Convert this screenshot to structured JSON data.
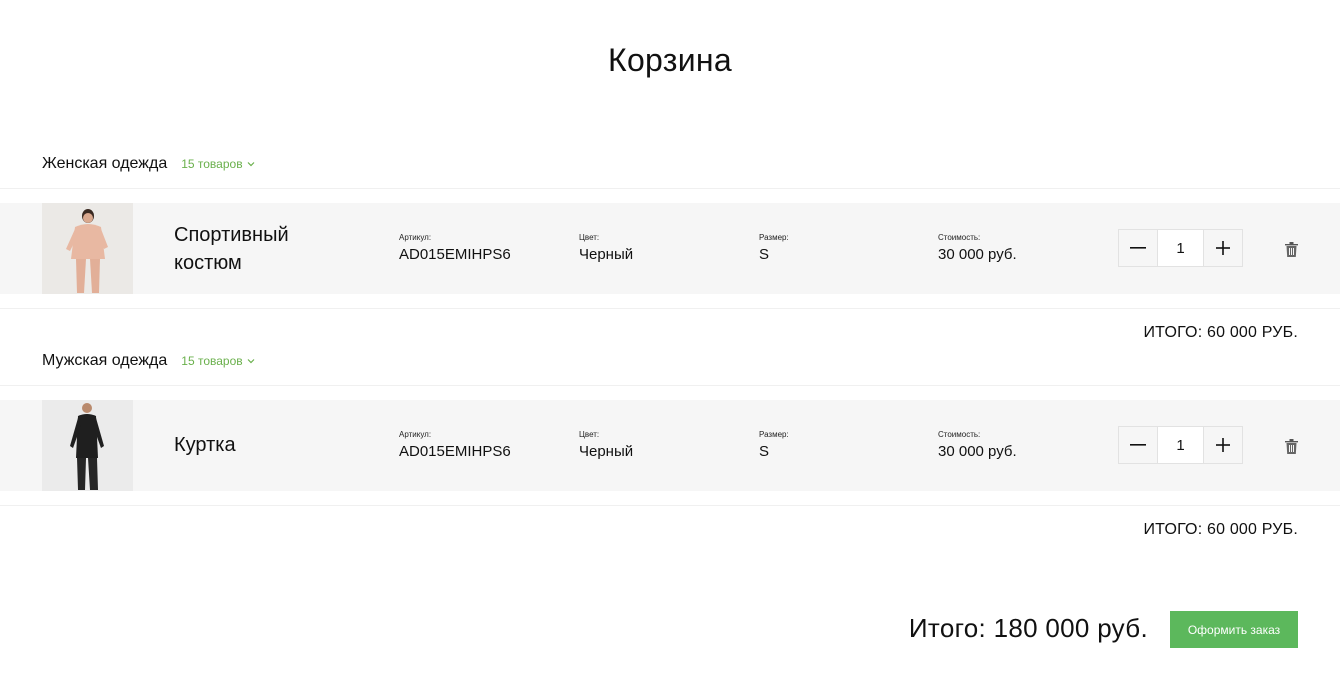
{
  "page": {
    "title": "Корзина"
  },
  "sections": [
    {
      "title": "Женская одежда",
      "count": "15 товаров",
      "item": {
        "name_line1": "Спортивный",
        "name_line2": "костюм",
        "sku_label": "Артикул:",
        "sku": "AD015EMIHPS6",
        "color_label": "Цвет:",
        "color": "Черный",
        "size_label": "Размер:",
        "size": "S",
        "price_label": "Стоимость:",
        "price": "30 000 руб.",
        "quantity": "1"
      },
      "subtotal": "ИТОГО: 60 000 РУБ."
    },
    {
      "title": "Мужская одежда",
      "count": "15 товаров",
      "item": {
        "name_line1": "Куртка",
        "sku_label": "Артикул:",
        "sku": "AD015EMIHPS6",
        "color_label": "Цвет:",
        "color": "Черный",
        "size_label": "Размер:",
        "size": "S",
        "price_label": "Стоимость:",
        "price": "30 000 руб.",
        "quantity": "1"
      },
      "subtotal": "ИТОГО: 60 000 РУБ."
    }
  ],
  "footer": {
    "total": "Итого: 180 000 руб.",
    "checkout_label": "Оформить заказ"
  },
  "colors": {
    "accent": "#5cb85c",
    "count_text": "#6ab04c",
    "row_bg": "#f6f6f6"
  },
  "icons": [
    "chevron-down-icon",
    "minus-icon",
    "plus-icon",
    "trash-icon"
  ]
}
